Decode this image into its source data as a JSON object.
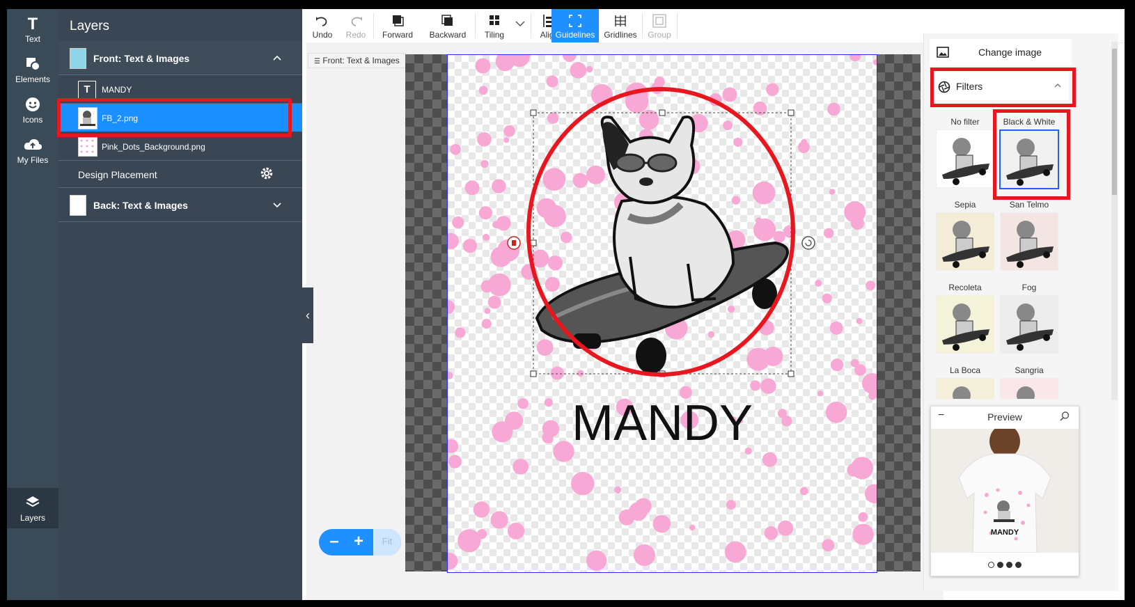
{
  "rail": {
    "items": [
      {
        "label": "Text"
      },
      {
        "label": "Elements"
      },
      {
        "label": "Icons"
      },
      {
        "label": "My Files"
      }
    ],
    "bottom": {
      "label": "Layers"
    }
  },
  "layers": {
    "title": "Layers",
    "front_group": "Front: Text & Images",
    "items": [
      "MANDY",
      "FB_2.png",
      "Pink_Dots_Background.png"
    ],
    "selected_item": "FB_2.png",
    "design_placement": "Design Placement",
    "back_group": "Back: Text & Images"
  },
  "toolbar": {
    "undo": "Undo",
    "redo": "Redo",
    "forward": "Forward",
    "backward": "Backward",
    "tiling": "Tiling",
    "align": "Align",
    "guidelines": "Guidelines",
    "gridlines": "Gridlines",
    "group": "Group"
  },
  "breadcrumb": "Front: Text & Images",
  "canvas": {
    "text_layer": "MANDY"
  },
  "zoom": {
    "minus": "–",
    "plus": "+",
    "fit": "Fit"
  },
  "right_panel": {
    "change_image": "Change image",
    "filters_title": "Filters",
    "filters": [
      "No filter",
      "Black & White",
      "Sepia",
      "San Telmo",
      "Recoleta",
      "Fog",
      "La Boca",
      "Sangria"
    ],
    "selected_filter": "Black & White"
  },
  "preview": {
    "title": "Preview",
    "shirt_text": "MANDY",
    "dots": 4
  }
}
